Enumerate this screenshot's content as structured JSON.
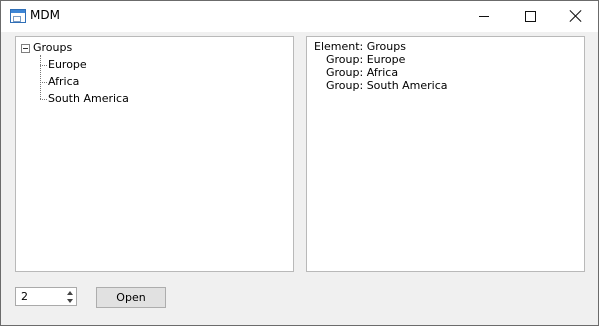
{
  "window": {
    "title": "MDM"
  },
  "tree": {
    "root_label": "Groups",
    "items": [
      "Europe",
      "Africa",
      "South America"
    ]
  },
  "info": {
    "lines": [
      "Element: Groups",
      "Group: Europe",
      "Group: Africa",
      "Group: South America"
    ]
  },
  "controls": {
    "stepper_value": "2",
    "open_label": "Open"
  },
  "icons": {
    "app": "window-icon",
    "minimize": "minimize-icon",
    "maximize": "maximize-icon",
    "close": "close-icon",
    "collapse": "collapse-icon"
  }
}
